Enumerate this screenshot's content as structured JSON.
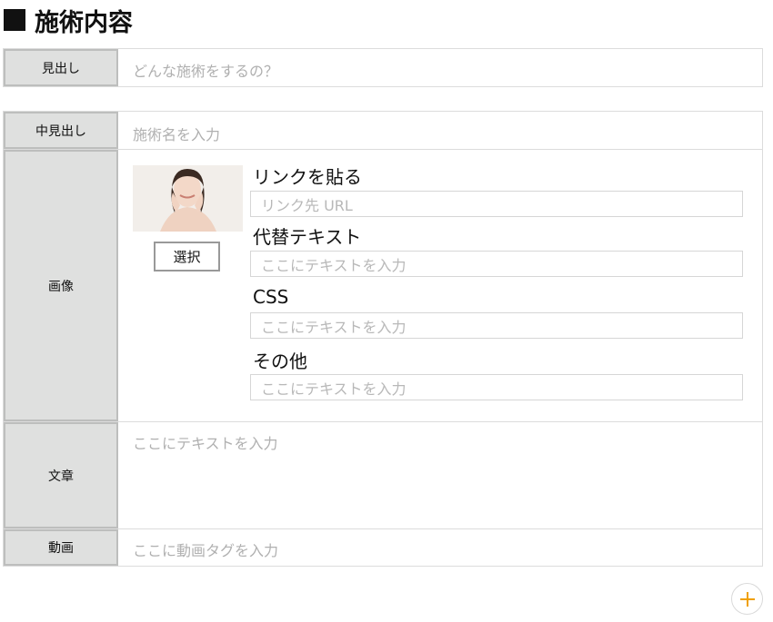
{
  "section": {
    "title": "施術内容"
  },
  "heading_row": {
    "label": "見出し",
    "placeholder": "どんな施術をするの？"
  },
  "subheading_row": {
    "label": "中見出し",
    "placeholder": "施術名を入力"
  },
  "image_row": {
    "label": "画像",
    "select_button": "選択",
    "fields": [
      {
        "label": "リンクを貼る",
        "placeholder": "リンク先 URL"
      },
      {
        "label": "代替テキスト",
        "placeholder": "ここにテキストを入力"
      },
      {
        "label": "CSS",
        "placeholder": "ここにテキストを入力"
      },
      {
        "label": "その他",
        "placeholder": "ここにテキストを入力"
      }
    ]
  },
  "text_row": {
    "label": "文章",
    "placeholder": "ここにテキストを入力"
  },
  "video_row": {
    "label": "動画",
    "placeholder": "ここに動画タグを入力"
  },
  "colors": {
    "accent": "#f0a000",
    "label_bg": "#dfe0df",
    "label_border": "#bdbebd"
  }
}
